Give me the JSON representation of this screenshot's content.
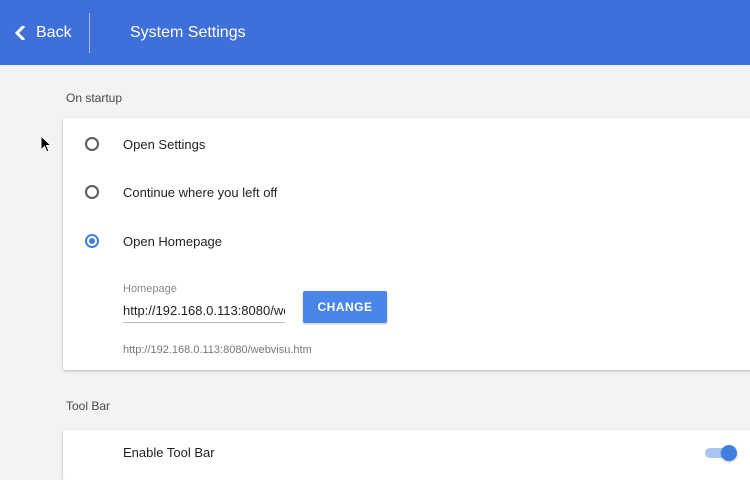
{
  "header": {
    "back_label": "Back",
    "title": "System Settings",
    "background": "#3f6fd8"
  },
  "startup": {
    "section_label": "On startup",
    "options": [
      {
        "label": "Open Settings",
        "checked": false
      },
      {
        "label": "Continue where you left off",
        "checked": false
      },
      {
        "label": "Open Homepage",
        "checked": true
      }
    ],
    "homepage": {
      "caption": "Homepage",
      "value": "http://192.168.0.113:8080/webvisu.htm",
      "change_label": "CHANGE",
      "url_display": "http://192.168.0.113:8080/webvisu.htm"
    }
  },
  "toolbar": {
    "section_label": "Tool Bar",
    "enable_label": "Enable Tool Bar",
    "enabled": true
  },
  "colors": {
    "accent": "#4a86e8",
    "radio_checked": "#3f7fe0"
  }
}
